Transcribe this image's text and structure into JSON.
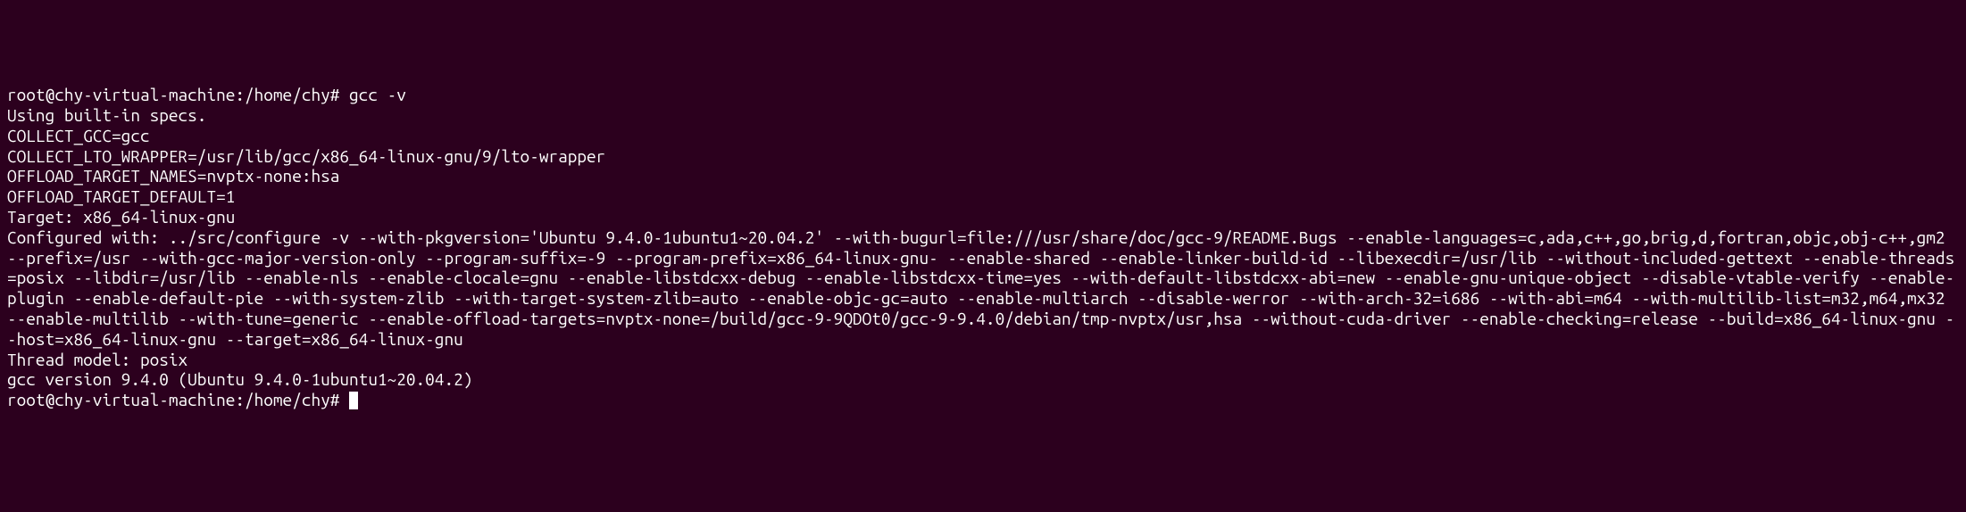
{
  "terminal": {
    "prompt1": "root@chy-virtual-machine:/home/chy# ",
    "command1": "gcc -v",
    "lines": [
      "Using built-in specs.",
      "COLLECT_GCC=gcc",
      "COLLECT_LTO_WRAPPER=/usr/lib/gcc/x86_64-linux-gnu/9/lto-wrapper",
      "OFFLOAD_TARGET_NAMES=nvptx-none:hsa",
      "OFFLOAD_TARGET_DEFAULT=1",
      "Target: x86_64-linux-gnu",
      "Configured with: ../src/configure -v --with-pkgversion='Ubuntu 9.4.0-1ubuntu1~20.04.2' --with-bugurl=file:///usr/share/doc/gcc-9/README.Bugs --enable-languages=c,ada,c++,go,brig,d,fortran,objc,obj-c++,gm2 --prefix=/usr --with-gcc-major-version-only --program-suffix=-9 --program-prefix=x86_64-linux-gnu- --enable-shared --enable-linker-build-id --libexecdir=/usr/lib --without-included-gettext --enable-threads=posix --libdir=/usr/lib --enable-nls --enable-clocale=gnu --enable-libstdcxx-debug --enable-libstdcxx-time=yes --with-default-libstdcxx-abi=new --enable-gnu-unique-object --disable-vtable-verify --enable-plugin --enable-default-pie --with-system-zlib --with-target-system-zlib=auto --enable-objc-gc=auto --enable-multiarch --disable-werror --with-arch-32=i686 --with-abi=m64 --with-multilib-list=m32,m64,mx32 --enable-multilib --with-tune=generic --enable-offload-targets=nvptx-none=/build/gcc-9-9QDOt0/gcc-9-9.4.0/debian/tmp-nvptx/usr,hsa --without-cuda-driver --enable-checking=release --build=x86_64-linux-gnu --host=x86_64-linux-gnu --target=x86_64-linux-gnu",
      "Thread model: posix",
      "gcc version 9.4.0 (Ubuntu 9.4.0-1ubuntu1~20.04.2)"
    ],
    "prompt2": "root@chy-virtual-machine:/home/chy# "
  }
}
